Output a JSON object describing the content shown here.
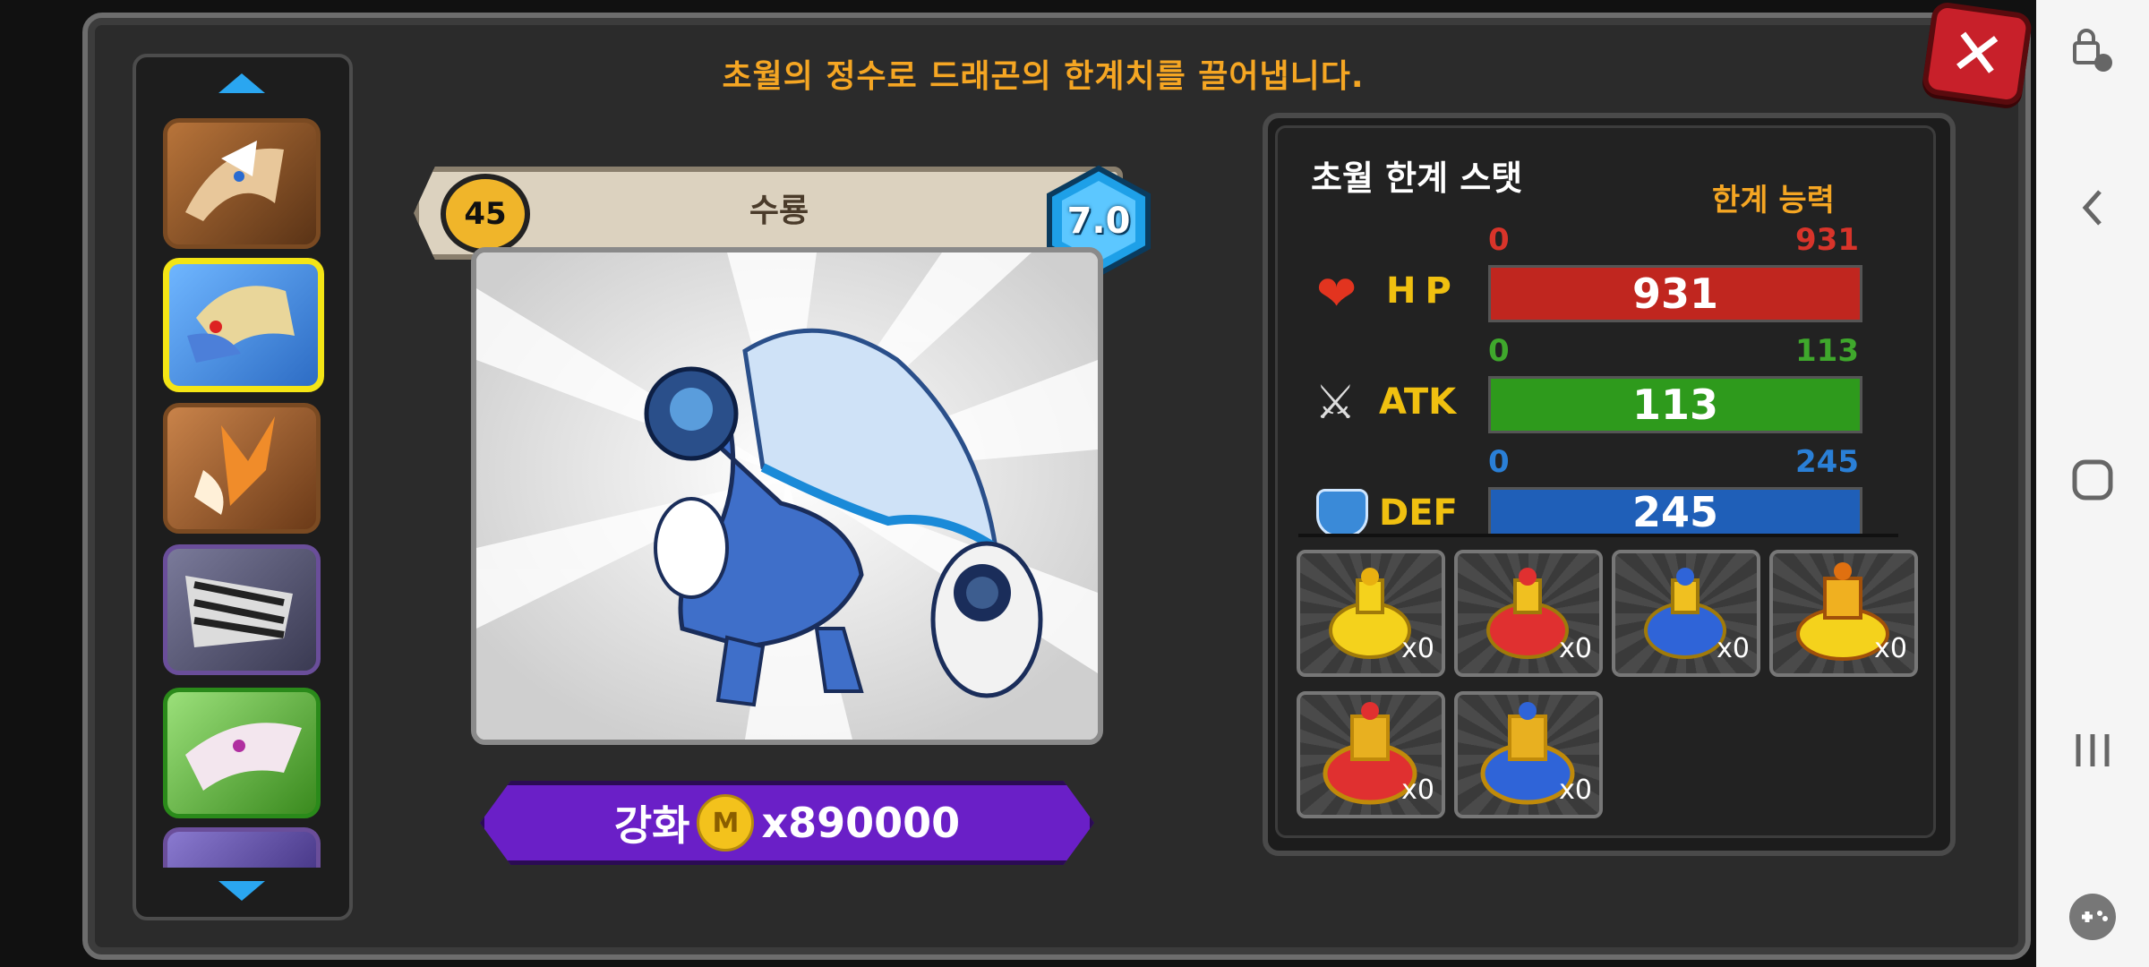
{
  "header": {
    "title": "초월의 정수로 드래곤의 한계치를 끌어냅니다."
  },
  "dragon": {
    "level": "45",
    "name": "수룡",
    "grade": "7.0"
  },
  "upgrade": {
    "label": "강화",
    "coin_symbol": "M",
    "cost": "x890000"
  },
  "stats": {
    "title": "초월 한계 스탯",
    "limit_label": "한계 능력",
    "hp": {
      "label": "HP",
      "min": "0",
      "max": "931",
      "value": "931",
      "fill": 1.0,
      "color": "#c0261f"
    },
    "atk": {
      "label": "ATK",
      "min": "0",
      "max": "113",
      "value": "113",
      "fill": 1.0,
      "color": "#2e9a1c"
    },
    "def": {
      "label": "DEF",
      "min": "0",
      "max": "245",
      "value": "245",
      "fill": 1.0,
      "color": "#1f5fb8"
    }
  },
  "potions": [
    {
      "color": "yellow",
      "count": "x0"
    },
    {
      "color": "red",
      "count": "x0"
    },
    {
      "color": "blue",
      "count": "x0"
    },
    {
      "color": "gold",
      "count": "x0"
    },
    {
      "color": "red-large",
      "count": "x0"
    },
    {
      "color": "blue-large",
      "count": "x0"
    }
  ],
  "dragon_list": [
    "brown-dragon",
    "water-dragon",
    "orange-dragon",
    "zebra-dragon",
    "pink-dragon",
    "partial-dragon"
  ],
  "nav": [
    "touch-lock-icon",
    "back-icon",
    "home-icon",
    "recents-icon",
    "game-tools-icon"
  ]
}
